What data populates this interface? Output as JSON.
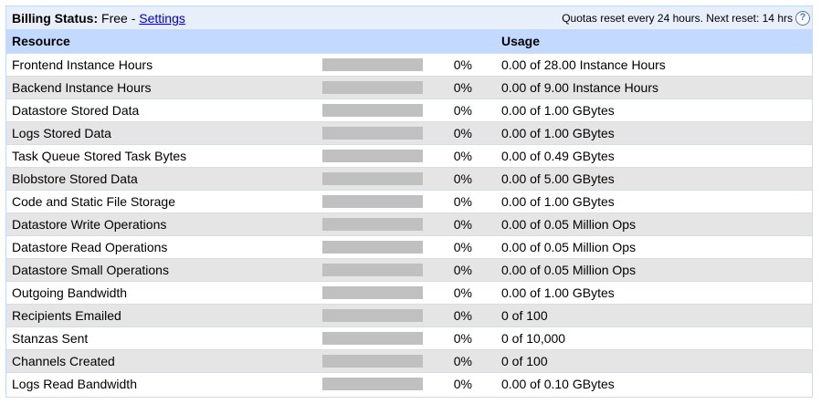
{
  "billing": {
    "label": "Billing Status:",
    "status": "Free",
    "separator": "-",
    "settings_link": "Settings",
    "quota_note": "Quotas reset every 24 hours. Next reset: 14 hrs",
    "help_icon": "?"
  },
  "table": {
    "headers": {
      "resource": "Resource",
      "usage": "Usage"
    },
    "rows": [
      {
        "resource": "Frontend Instance Hours",
        "percent": "0%",
        "fraction": 0,
        "usage": "0.00 of 28.00 Instance Hours"
      },
      {
        "resource": "Backend Instance Hours",
        "percent": "0%",
        "fraction": 0,
        "usage": "0.00 of 9.00 Instance Hours"
      },
      {
        "resource": "Datastore Stored Data",
        "percent": "0%",
        "fraction": 0,
        "usage": "0.00 of 1.00 GBytes"
      },
      {
        "resource": "Logs Stored Data",
        "percent": "0%",
        "fraction": 0,
        "usage": "0.00 of 1.00 GBytes"
      },
      {
        "resource": "Task Queue Stored Task Bytes",
        "percent": "0%",
        "fraction": 0,
        "usage": "0.00 of 0.49 GBytes"
      },
      {
        "resource": "Blobstore Stored Data",
        "percent": "0%",
        "fraction": 0,
        "usage": "0.00 of 5.00 GBytes"
      },
      {
        "resource": "Code and Static File Storage",
        "percent": "0%",
        "fraction": 0,
        "usage": "0.00 of 1.00 GBytes"
      },
      {
        "resource": "Datastore Write Operations",
        "percent": "0%",
        "fraction": 0,
        "usage": "0.00 of 0.05 Million Ops"
      },
      {
        "resource": "Datastore Read Operations",
        "percent": "0%",
        "fraction": 0,
        "usage": "0.00 of 0.05 Million Ops"
      },
      {
        "resource": "Datastore Small Operations",
        "percent": "0%",
        "fraction": 0,
        "usage": "0.00 of 0.05 Million Ops"
      },
      {
        "resource": "Outgoing Bandwidth",
        "percent": "0%",
        "fraction": 0,
        "usage": "0.00 of 1.00 GBytes"
      },
      {
        "resource": "Recipients Emailed",
        "percent": "0%",
        "fraction": 0,
        "usage": "0 of 100"
      },
      {
        "resource": "Stanzas Sent",
        "percent": "0%",
        "fraction": 0,
        "usage": "0 of 10,000"
      },
      {
        "resource": "Channels Created",
        "percent": "0%",
        "fraction": 0,
        "usage": "0 of 100"
      },
      {
        "resource": "Logs Read Bandwidth",
        "percent": "0%",
        "fraction": 0,
        "usage": "0.00 of 0.10 GBytes"
      }
    ]
  },
  "colors": {
    "header_bg": "#c3d9ff",
    "status_bg": "#e8eefa",
    "bar_empty": "#c0c0c0",
    "bar_fill": "#4a78c4",
    "alt_row": "#e5e5e5",
    "link": "#0000cc"
  }
}
